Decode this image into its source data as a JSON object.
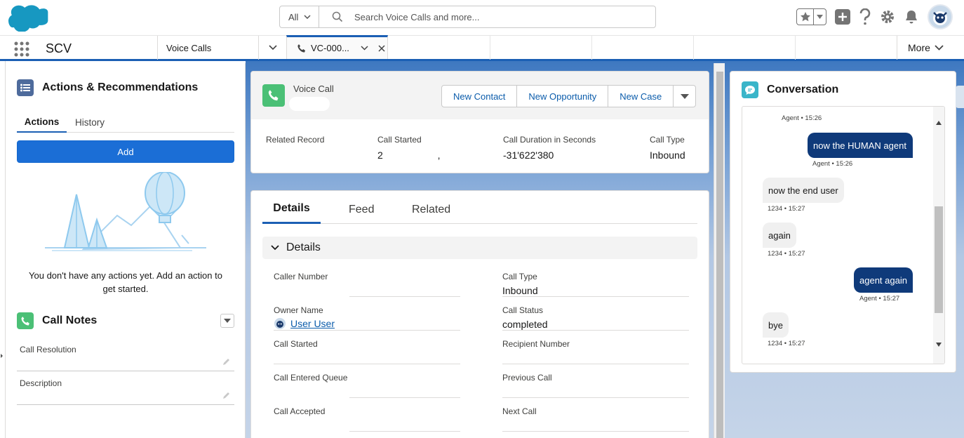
{
  "header": {
    "search_scope": "All",
    "search_placeholder": "Search Voice Calls and more..."
  },
  "nav": {
    "app_name": "SCV",
    "tab_voice_calls": "Voice Calls",
    "tab_active_label": "VC-000...",
    "more_label": "More"
  },
  "actions_panel": {
    "title": "Actions & Recommendations",
    "tabs": [
      "Actions",
      "History"
    ],
    "add_label": "Add",
    "empty_text": "You don't have any actions yet. Add an action to get started."
  },
  "call_notes": {
    "title": "Call Notes",
    "fields": [
      "Call Resolution",
      "Description"
    ]
  },
  "record": {
    "object_label": "Voice Call",
    "buttons": [
      "New Contact",
      "New Opportunity",
      "New Case"
    ],
    "highlights": [
      {
        "label": "Related Record",
        "value": ""
      },
      {
        "label": "Call Started",
        "value": "2                    ,"
      },
      {
        "label": "Call Duration in Seconds",
        "value": "-31'622'380"
      },
      {
        "label": "Call Type",
        "value": "Inbound"
      }
    ]
  },
  "details": {
    "tabs": [
      "Details",
      "Feed",
      "Related"
    ],
    "section_title": "Details",
    "left_fields": [
      {
        "label": "Caller Number",
        "value": ""
      },
      {
        "label": "Owner Name",
        "value": "User User"
      },
      {
        "label": "Call Started",
        "value": ""
      },
      {
        "label": "Call Entered Queue",
        "value": ""
      },
      {
        "label": "Call Accepted",
        "value": ""
      }
    ],
    "right_fields": [
      {
        "label": "Call Type",
        "value": "Inbound"
      },
      {
        "label": "Call Status",
        "value": "completed"
      },
      {
        "label": "Recipient Number",
        "value": ""
      },
      {
        "label": "Previous Call",
        "value": ""
      },
      {
        "label": "Next Call",
        "value": ""
      }
    ]
  },
  "conversation": {
    "title": "Conversation",
    "top_meta": "Agent • 15:26",
    "messages": [
      {
        "from": "agent",
        "text": "now the HUMAN agent",
        "meta": "Agent • 15:26"
      },
      {
        "from": "user",
        "text": "now the end user",
        "meta": "1234 • 15:27"
      },
      {
        "from": "user",
        "text": "again",
        "meta": "1234 • 15:27"
      },
      {
        "from": "agent",
        "text": "agent again",
        "meta": "Agent • 15:27"
      },
      {
        "from": "user",
        "text": "bye",
        "meta": "1234 • 15:27"
      }
    ]
  },
  "colors": {
    "brand_blue": "#1b5fb4",
    "button_blue": "#1b6ed6",
    "agent_bubble": "#0f3a7a",
    "phone_green": "#4bc076",
    "link_blue": "#0b5cab"
  }
}
